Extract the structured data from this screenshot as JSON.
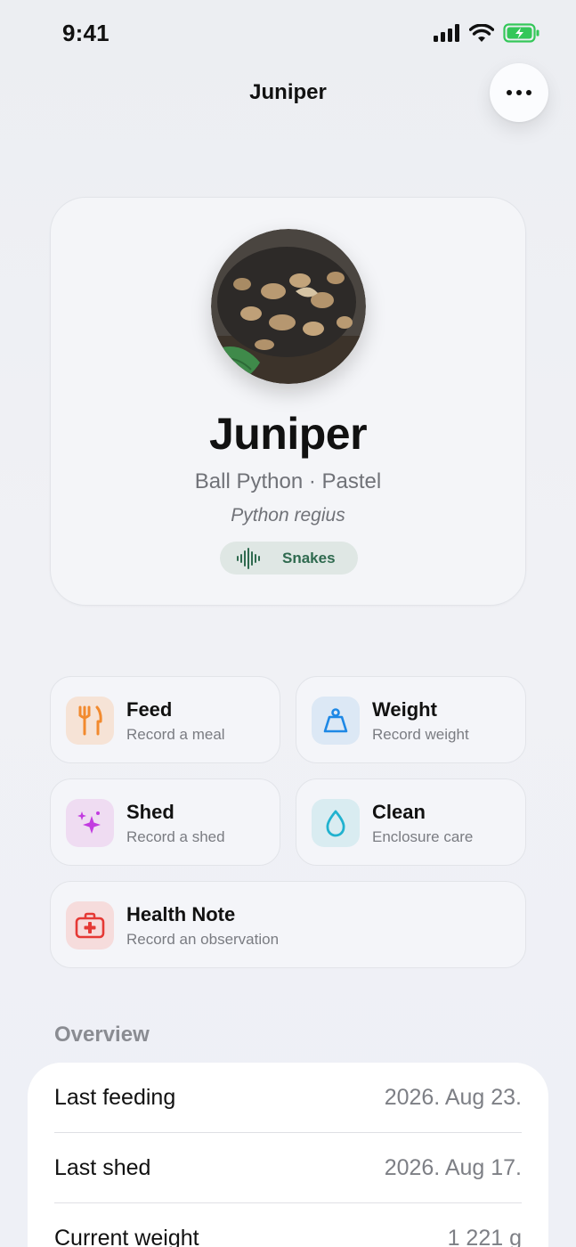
{
  "status_bar": {
    "time": "9:41"
  },
  "nav": {
    "title": "Juniper"
  },
  "profile": {
    "name": "Juniper",
    "breed": "Ball Python · Pastel",
    "scientific_name": "Python regius",
    "group": "Snakes"
  },
  "actions": [
    {
      "title": "Feed",
      "subtitle": "Record a meal",
      "icon": "fork-knife-icon",
      "color": "#f28a2e",
      "bg": "#f6e3d6"
    },
    {
      "title": "Weight",
      "subtitle": "Record weight",
      "icon": "scale-weight-icon",
      "color": "#1e88e5",
      "bg": "#dce8f5"
    },
    {
      "title": "Shed",
      "subtitle": "Record a shed",
      "icon": "sparkles-icon",
      "color": "#c23be0",
      "bg": "#efdcf2"
    },
    {
      "title": "Clean",
      "subtitle": "Enclosure care",
      "icon": "water-drop-icon",
      "color": "#20b2cf",
      "bg": "#d9ecf1"
    },
    {
      "title": "Health Note",
      "subtitle": "Record an observation",
      "icon": "medical-kit-icon",
      "color": "#e53935",
      "bg": "#f6dcdc"
    }
  ],
  "overview": {
    "header": "Overview",
    "rows": [
      {
        "label": "Last feeding",
        "value": "2026. Aug 23."
      },
      {
        "label": "Last shed",
        "value": "2026. Aug 17."
      },
      {
        "label": "Current weight",
        "value": "1 221 g"
      }
    ]
  }
}
